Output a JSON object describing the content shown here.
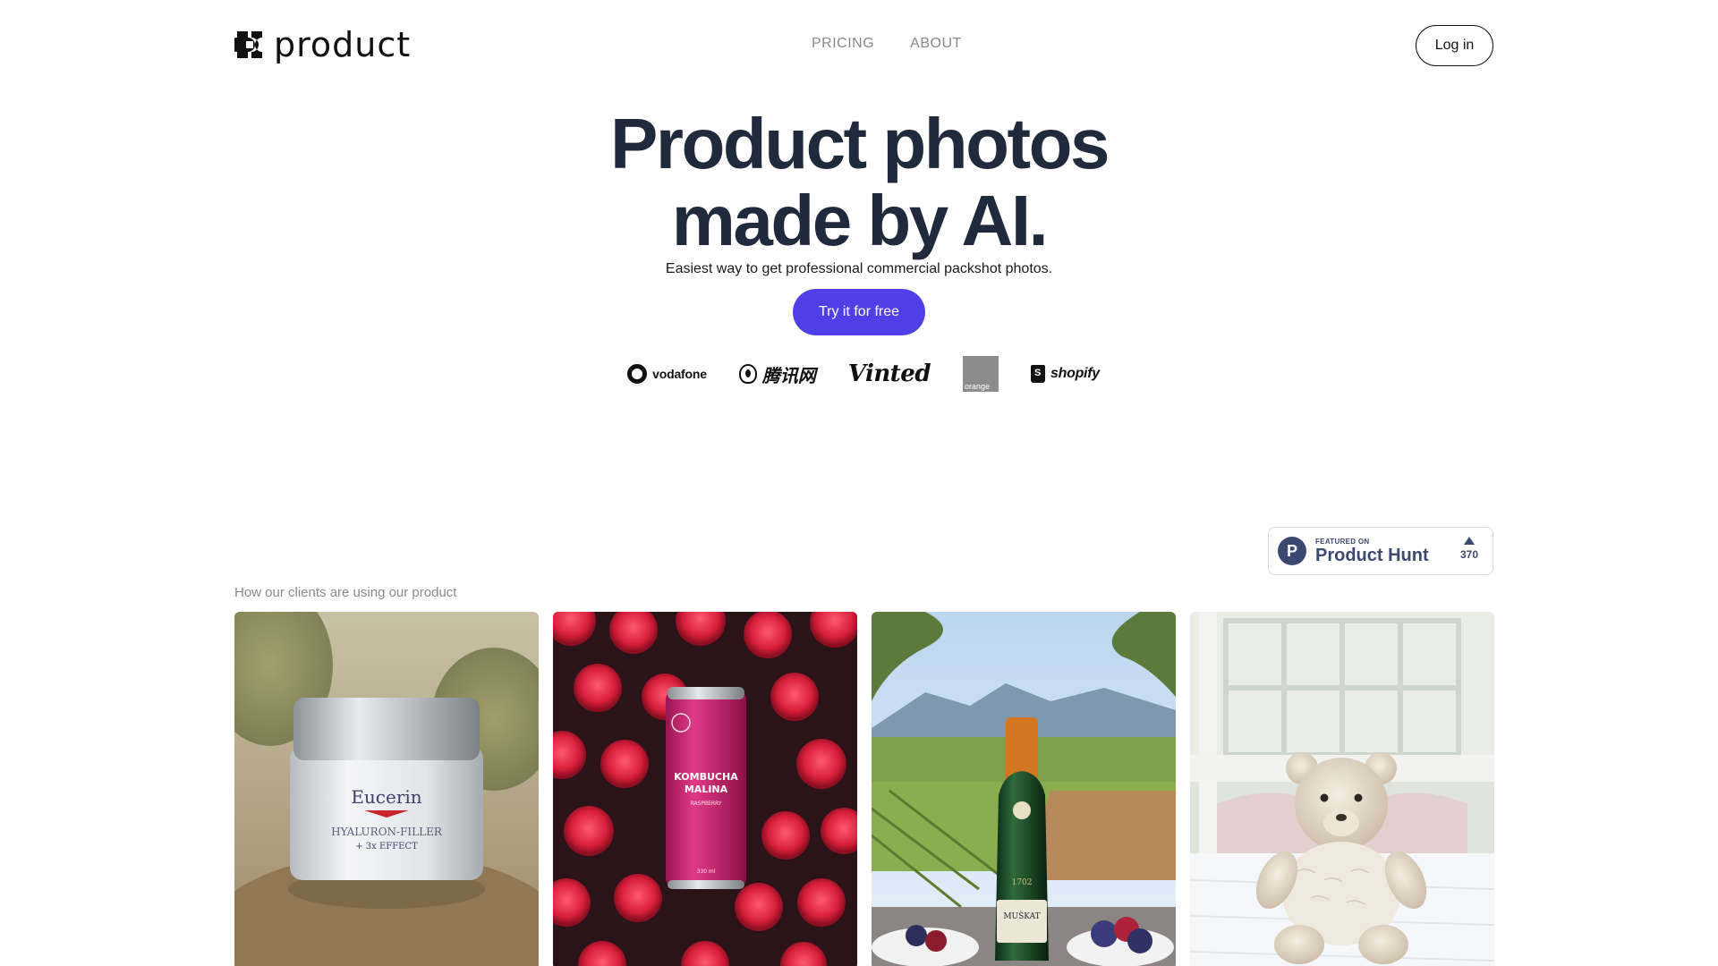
{
  "header": {
    "logo_text": "product",
    "logo_icon": "four-petal-logo-icon",
    "nav": [
      {
        "label": "PRICING"
      },
      {
        "label": "ABOUT"
      }
    ],
    "login_label": "Log in"
  },
  "hero": {
    "title_line1": "Product photos",
    "title_line2": "made by AI.",
    "subtitle": "Easiest way to get professional commercial packshot photos.",
    "cta_label": "Try it for free"
  },
  "brands": [
    {
      "name": "vodafone"
    },
    {
      "name": "腾讯网"
    },
    {
      "name": "Vinted"
    },
    {
      "name": "orange"
    },
    {
      "name": "shopify"
    }
  ],
  "product_hunt": {
    "featured_label": "FEATURED ON",
    "name": "Product Hunt",
    "votes": "370",
    "icon_letter": "P"
  },
  "gallery": {
    "label": "How our clients are using our product",
    "cards": [
      {
        "brand": "Eucerin",
        "line1": "HYALURON-FILLER",
        "line2": "+ 3x EFFECT"
      },
      {
        "brand": "KOMBUCHA",
        "line1": "MALINA",
        "line2": "RASPBERRY",
        "volume": "330 ml"
      },
      {
        "brand": "MUŠKAT",
        "line1": "1702"
      },
      {
        "brand": ""
      }
    ]
  },
  "colors": {
    "cta": "#4f3fe6",
    "title": "#1f2a3c",
    "product_hunt": "#3d4870",
    "muted": "#8a8a8a"
  }
}
